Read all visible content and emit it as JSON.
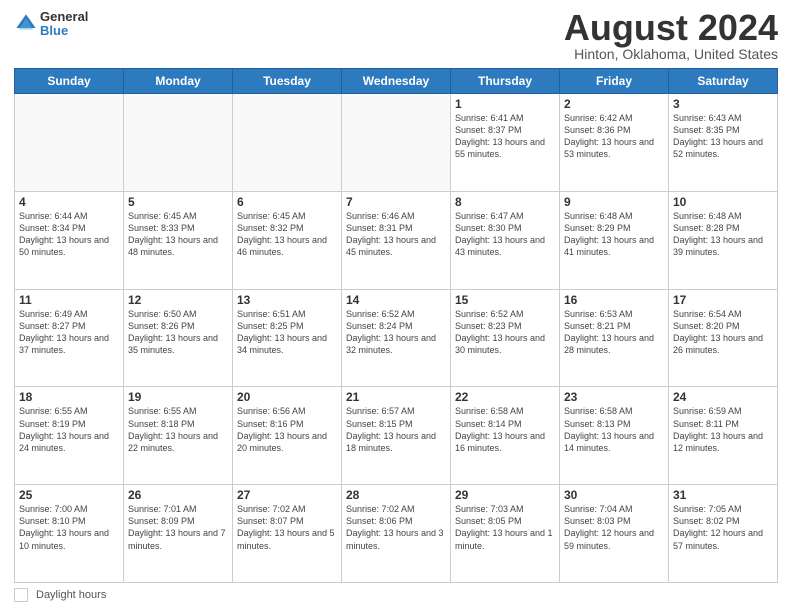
{
  "header": {
    "logo_general": "General",
    "logo_blue": "Blue",
    "month_title": "August 2024",
    "location": "Hinton, Oklahoma, United States"
  },
  "calendar": {
    "days_of_week": [
      "Sunday",
      "Monday",
      "Tuesday",
      "Wednesday",
      "Thursday",
      "Friday",
      "Saturday"
    ],
    "weeks": [
      [
        {
          "day": "",
          "info": ""
        },
        {
          "day": "",
          "info": ""
        },
        {
          "day": "",
          "info": ""
        },
        {
          "day": "",
          "info": ""
        },
        {
          "day": "1",
          "info": "Sunrise: 6:41 AM\nSunset: 8:37 PM\nDaylight: 13 hours and 55 minutes."
        },
        {
          "day": "2",
          "info": "Sunrise: 6:42 AM\nSunset: 8:36 PM\nDaylight: 13 hours and 53 minutes."
        },
        {
          "day": "3",
          "info": "Sunrise: 6:43 AM\nSunset: 8:35 PM\nDaylight: 13 hours and 52 minutes."
        }
      ],
      [
        {
          "day": "4",
          "info": "Sunrise: 6:44 AM\nSunset: 8:34 PM\nDaylight: 13 hours and 50 minutes."
        },
        {
          "day": "5",
          "info": "Sunrise: 6:45 AM\nSunset: 8:33 PM\nDaylight: 13 hours and 48 minutes."
        },
        {
          "day": "6",
          "info": "Sunrise: 6:45 AM\nSunset: 8:32 PM\nDaylight: 13 hours and 46 minutes."
        },
        {
          "day": "7",
          "info": "Sunrise: 6:46 AM\nSunset: 8:31 PM\nDaylight: 13 hours and 45 minutes."
        },
        {
          "day": "8",
          "info": "Sunrise: 6:47 AM\nSunset: 8:30 PM\nDaylight: 13 hours and 43 minutes."
        },
        {
          "day": "9",
          "info": "Sunrise: 6:48 AM\nSunset: 8:29 PM\nDaylight: 13 hours and 41 minutes."
        },
        {
          "day": "10",
          "info": "Sunrise: 6:48 AM\nSunset: 8:28 PM\nDaylight: 13 hours and 39 minutes."
        }
      ],
      [
        {
          "day": "11",
          "info": "Sunrise: 6:49 AM\nSunset: 8:27 PM\nDaylight: 13 hours and 37 minutes."
        },
        {
          "day": "12",
          "info": "Sunrise: 6:50 AM\nSunset: 8:26 PM\nDaylight: 13 hours and 35 minutes."
        },
        {
          "day": "13",
          "info": "Sunrise: 6:51 AM\nSunset: 8:25 PM\nDaylight: 13 hours and 34 minutes."
        },
        {
          "day": "14",
          "info": "Sunrise: 6:52 AM\nSunset: 8:24 PM\nDaylight: 13 hours and 32 minutes."
        },
        {
          "day": "15",
          "info": "Sunrise: 6:52 AM\nSunset: 8:23 PM\nDaylight: 13 hours and 30 minutes."
        },
        {
          "day": "16",
          "info": "Sunrise: 6:53 AM\nSunset: 8:21 PM\nDaylight: 13 hours and 28 minutes."
        },
        {
          "day": "17",
          "info": "Sunrise: 6:54 AM\nSunset: 8:20 PM\nDaylight: 13 hours and 26 minutes."
        }
      ],
      [
        {
          "day": "18",
          "info": "Sunrise: 6:55 AM\nSunset: 8:19 PM\nDaylight: 13 hours and 24 minutes."
        },
        {
          "day": "19",
          "info": "Sunrise: 6:55 AM\nSunset: 8:18 PM\nDaylight: 13 hours and 22 minutes."
        },
        {
          "day": "20",
          "info": "Sunrise: 6:56 AM\nSunset: 8:16 PM\nDaylight: 13 hours and 20 minutes."
        },
        {
          "day": "21",
          "info": "Sunrise: 6:57 AM\nSunset: 8:15 PM\nDaylight: 13 hours and 18 minutes."
        },
        {
          "day": "22",
          "info": "Sunrise: 6:58 AM\nSunset: 8:14 PM\nDaylight: 13 hours and 16 minutes."
        },
        {
          "day": "23",
          "info": "Sunrise: 6:58 AM\nSunset: 8:13 PM\nDaylight: 13 hours and 14 minutes."
        },
        {
          "day": "24",
          "info": "Sunrise: 6:59 AM\nSunset: 8:11 PM\nDaylight: 13 hours and 12 minutes."
        }
      ],
      [
        {
          "day": "25",
          "info": "Sunrise: 7:00 AM\nSunset: 8:10 PM\nDaylight: 13 hours and 10 minutes."
        },
        {
          "day": "26",
          "info": "Sunrise: 7:01 AM\nSunset: 8:09 PM\nDaylight: 13 hours and 7 minutes."
        },
        {
          "day": "27",
          "info": "Sunrise: 7:02 AM\nSunset: 8:07 PM\nDaylight: 13 hours and 5 minutes."
        },
        {
          "day": "28",
          "info": "Sunrise: 7:02 AM\nSunset: 8:06 PM\nDaylight: 13 hours and 3 minutes."
        },
        {
          "day": "29",
          "info": "Sunrise: 7:03 AM\nSunset: 8:05 PM\nDaylight: 13 hours and 1 minute."
        },
        {
          "day": "30",
          "info": "Sunrise: 7:04 AM\nSunset: 8:03 PM\nDaylight: 12 hours and 59 minutes."
        },
        {
          "day": "31",
          "info": "Sunrise: 7:05 AM\nSunset: 8:02 PM\nDaylight: 12 hours and 57 minutes."
        }
      ]
    ]
  },
  "footer": {
    "daylight_label": "Daylight hours"
  }
}
